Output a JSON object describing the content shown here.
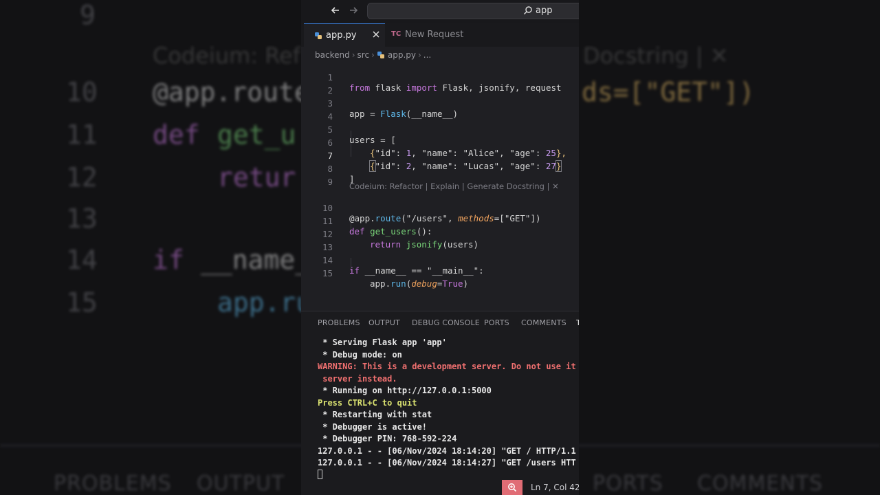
{
  "background": {
    "codelens_fragment_left": "Codeium: Ref",
    "codelens_fragment_right": "Docstring | ✕",
    "line_numbers": [
      "9",
      "10",
      "11",
      "12",
      "13",
      "14",
      "15"
    ],
    "code_fragments": {
      "route": "@app.route",
      "route_right": "ds=[\"GET\"])",
      "def": "def",
      "get_users": "get_u",
      "return": "retur",
      "if": "if",
      "name": "__name_",
      "app_run": "app.ru"
    },
    "panel_tabs": [
      "PROBLEMS",
      "OUTPUT",
      "PORTS",
      "COMMENTS"
    ]
  },
  "titlebar": {
    "search_text": "app"
  },
  "tabs": [
    {
      "label": "app.py",
      "active": true
    },
    {
      "label": "New Request",
      "active": false,
      "icon_text": "TC"
    }
  ],
  "breadcrumb": [
    "backend",
    "src",
    "app.py",
    "..."
  ],
  "code": {
    "line_numbers": [
      "1",
      "2",
      "3",
      "4",
      "5",
      "6",
      "7",
      "8",
      "9",
      "10",
      "11",
      "12",
      "13",
      "14",
      "15"
    ],
    "codelens": "Codeium: Refactor | Explain | Generate Docstring | ✕",
    "tokens": {
      "from": "from",
      "flask": " flask ",
      "import": "import",
      "imports": " Flask, jsonify, request",
      "app_assign": "app = ",
      "Flask": "Flask",
      "name_call": "(__name__)",
      "users_open": "users = [",
      "row1_a": "{",
      "row1_b": "\"id\": ",
      "row1_id": "1",
      "row1_c": ", \"name\": \"Alice\", \"age\": ",
      "row1_age": "25",
      "row1_d": "},",
      "row2_a": "{",
      "row2_b": "\"id\": ",
      "row2_id": "2",
      "row2_c": ", \"name\": \"Lucas\", \"age\": ",
      "row2_age": "27",
      "row2_d": "}",
      "close_bracket": "]",
      "deco_at": "@app.",
      "route": "route",
      "route_args_a": "(\"/users\", ",
      "methods": "methods",
      "route_args_b": "=[\"GET\"])",
      "def": "def",
      "get_users": " get_users",
      "def_tail": "():",
      "return": "return",
      "jsonify": " jsonify",
      "return_tail": "(users)",
      "if": "if",
      "if_cond": " __name__ == \"__main__\":",
      "app_dot": "app.",
      "run": "run",
      "run_open": "(",
      "debug": "debug",
      "run_eq": "=",
      "true": "True",
      "run_close": ")"
    }
  },
  "panel": {
    "tabs": [
      "PROBLEMS",
      "OUTPUT",
      "DEBUG CONSOLE",
      "PORTS",
      "COMMENTS",
      "T"
    ],
    "terminal": [
      " * Serving Flask app 'app'",
      " * Debug mode: on",
      "WARNING: This is a development server. Do not use it",
      " server instead.",
      " * Running on http://127.0.0.1:5000",
      "Press CTRL+C to quit",
      " * Restarting with stat",
      " * Debugger is active!",
      " * Debugger PIN: 768-592-224",
      "127.0.0.1 - - [06/Nov/2024 18:14:20] \"GET / HTTP/1.1",
      "127.0.0.1 - - [06/Nov/2024 18:14:27] \"GET /users HTT"
    ]
  },
  "statusbar": {
    "position": "Ln 7, Col 42"
  },
  "colors": {
    "keyword": "#c678dd",
    "function": "#5eb7e8",
    "warning": "#f07070",
    "accent": "#e06c75"
  }
}
